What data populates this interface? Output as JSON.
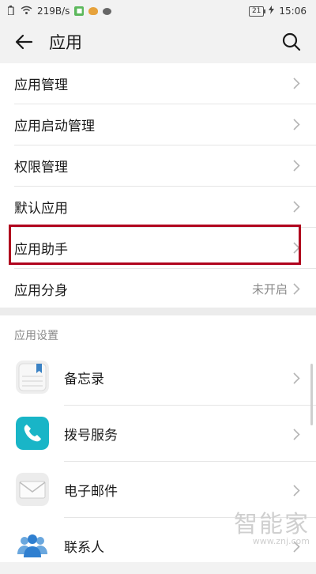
{
  "statusbar": {
    "net_speed": "219B/s",
    "battery": "21",
    "time": "15:06"
  },
  "header": {
    "title": "应用"
  },
  "menu": {
    "items": [
      {
        "label": "应用管理"
      },
      {
        "label": "应用启动管理"
      },
      {
        "label": "权限管理"
      },
      {
        "label": "默认应用"
      },
      {
        "label": "应用助手"
      },
      {
        "label": "应用分身",
        "value": "未开启"
      }
    ]
  },
  "settings": {
    "section_title": "应用设置",
    "apps": [
      {
        "label": "备忘录",
        "icon": "notepad-icon"
      },
      {
        "label": "拨号服务",
        "icon": "phone-icon"
      },
      {
        "label": "电子邮件",
        "icon": "email-icon"
      },
      {
        "label": "联系人",
        "icon": "contacts-icon"
      }
    ]
  },
  "watermark": {
    "title": "智能家",
    "url": "www.znj.com"
  },
  "colors": {
    "highlight": "#b0001d",
    "phone_icon": "#19b5c7"
  }
}
